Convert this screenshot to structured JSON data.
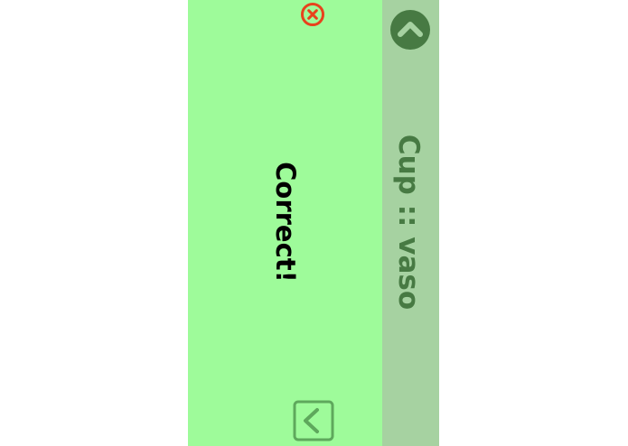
{
  "colors": {
    "main_panel_bg": "#9efb9a",
    "side_panel_bg": "#a6d2a1",
    "accent_dark_green": "#477a43",
    "close_icon": "#e8421c",
    "back_icon": "#5ea85c"
  },
  "feedback": {
    "text": "Correct!"
  },
  "flashcard": {
    "text": "Cup :: vaso"
  },
  "icons": {
    "close": "close-circle-x-icon",
    "back": "chevron-left-square-icon",
    "collapse": "chevron-up-circle-icon"
  }
}
